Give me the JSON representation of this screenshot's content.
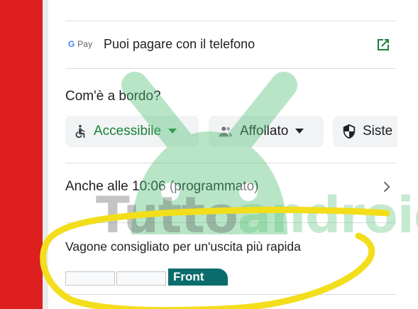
{
  "gpay": {
    "logo_g": "G",
    "logo_pay": "Pay",
    "text": "Puoi pagare con il telefono",
    "open_icon": "open-in-new-icon"
  },
  "onboard": {
    "title": "Com'è a bordo?",
    "chips": [
      {
        "label": "Accessibile",
        "icon": "accessible-icon"
      },
      {
        "label": "Affollato",
        "icon": "people-icon"
      },
      {
        "label": "Siste",
        "icon": "shield-icon"
      }
    ]
  },
  "also": {
    "prefix": "Anche alle ",
    "time": "10:06",
    "suffix": " (programmato)"
  },
  "carriage": {
    "title": "Vagone consigliato per un'uscita più rapida",
    "front_label": "Front"
  },
  "watermark": {
    "part1": "Tutto",
    "part2": "android"
  },
  "colors": {
    "red_bar": "#dd1f1f",
    "accent_green": "#188038",
    "front_teal": "#0b6c6c",
    "annotation_yellow": "#f2de1b"
  }
}
